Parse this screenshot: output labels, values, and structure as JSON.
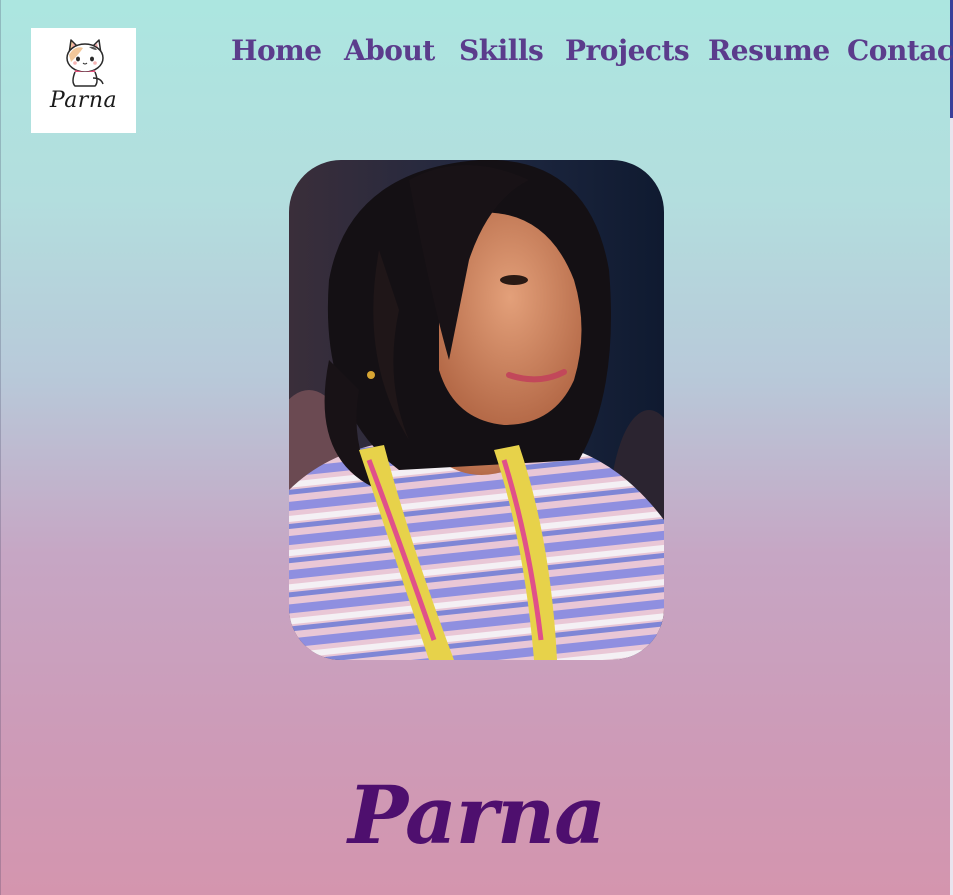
{
  "brand": {
    "logo_text": "Parna",
    "logo_icon": "cat-icon"
  },
  "nav": {
    "items": [
      {
        "label": "Home"
      },
      {
        "label": "About"
      },
      {
        "label": "Skills"
      },
      {
        "label": "Projects"
      },
      {
        "label": "Resume"
      },
      {
        "label": "Contact"
      }
    ]
  },
  "hero": {
    "photo_icon": "profile-photo",
    "name": "Parna"
  },
  "colors": {
    "nav_text": "#5b3c8c",
    "name_text": "#4e0f6e",
    "gradient_top": "#ace6e0",
    "gradient_bottom": "#d495ae"
  }
}
